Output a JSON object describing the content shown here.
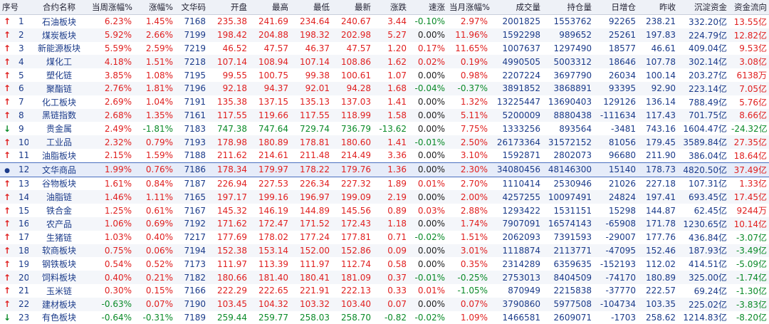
{
  "headers": [
    "序号",
    "合约名称",
    "当周涨幅%",
    "涨幅%",
    "文华码",
    "开盘",
    "最高",
    "最低",
    "最新",
    "涨跌",
    "速涨",
    "当月涨幅%",
    "成交量",
    "持仓量",
    "日增仓",
    "昨收",
    "沉淀资金",
    "资金流向"
  ],
  "rows": [
    {
      "arrow": "up",
      "n": "1",
      "name": "石油板块",
      "week": "6.23%",
      "chg": "1.45%",
      "code": "7168",
      "open": "235.38",
      "high": "241.69",
      "low": "234.64",
      "last": "240.67",
      "diff": "3.44",
      "speed": "-0.10%",
      "month": "2.97%",
      "vol": "2001825",
      "oi": "1553762",
      "doi": "92265",
      "prev": "238.21",
      "fund": "332.20亿",
      "flow": "13.55亿"
    },
    {
      "arrow": "up",
      "n": "2",
      "name": "煤炭板块",
      "week": "5.92%",
      "chg": "2.66%",
      "code": "7199",
      "open": "198.42",
      "high": "204.88",
      "low": "198.32",
      "last": "202.98",
      "diff": "5.27",
      "speed": "0.00%",
      "month": "11.96%",
      "vol": "1592298",
      "oi": "989652",
      "doi": "25261",
      "prev": "197.83",
      "fund": "224.79亿",
      "flow": "12.82亿"
    },
    {
      "arrow": "up",
      "n": "3",
      "name": "新能源板块",
      "week": "5.59%",
      "chg": "2.59%",
      "code": "7219",
      "open": "46.52",
      "high": "47.57",
      "low": "46.37",
      "last": "47.57",
      "diff": "1.20",
      "speed": "0.17%",
      "month": "11.65%",
      "vol": "1007637",
      "oi": "1297490",
      "doi": "18577",
      "prev": "46.61",
      "fund": "409.04亿",
      "flow": "9.53亿"
    },
    {
      "arrow": "up",
      "n": "4",
      "name": "煤化工",
      "week": "4.18%",
      "chg": "1.51%",
      "code": "7218",
      "open": "107.14",
      "high": "108.94",
      "low": "107.14",
      "last": "108.86",
      "diff": "1.62",
      "speed": "0.02%",
      "month": "0.19%",
      "vol": "4990505",
      "oi": "5003312",
      "doi": "18646",
      "prev": "107.78",
      "fund": "302.14亿",
      "flow": "3.08亿"
    },
    {
      "arrow": "up",
      "n": "5",
      "name": "塑化链",
      "week": "3.85%",
      "chg": "1.08%",
      "code": "7195",
      "open": "99.55",
      "high": "100.75",
      "low": "99.38",
      "last": "100.61",
      "diff": "1.07",
      "speed": "0.00%",
      "month": "0.98%",
      "vol": "2207224",
      "oi": "3697790",
      "doi": "26034",
      "prev": "100.14",
      "fund": "203.27亿",
      "flow": "6138万"
    },
    {
      "arrow": "up",
      "n": "6",
      "name": "聚酯链",
      "week": "2.76%",
      "chg": "1.81%",
      "code": "7196",
      "open": "92.18",
      "high": "94.37",
      "low": "92.01",
      "last": "94.28",
      "diff": "1.68",
      "speed": "-0.04%",
      "month": "-0.37%",
      "vol": "3891852",
      "oi": "3868891",
      "doi": "93395",
      "prev": "92.90",
      "fund": "223.14亿",
      "flow": "7.05亿"
    },
    {
      "arrow": "up",
      "n": "7",
      "name": "化工板块",
      "week": "2.69%",
      "chg": "1.04%",
      "code": "7191",
      "open": "135.38",
      "high": "137.15",
      "low": "135.13",
      "last": "137.03",
      "diff": "1.41",
      "speed": "0.00%",
      "month": "1.32%",
      "vol": "13225447",
      "oi": "13690403",
      "doi": "129126",
      "prev": "136.14",
      "fund": "788.49亿",
      "flow": "5.76亿"
    },
    {
      "arrow": "up",
      "n": "8",
      "name": "黑链指数",
      "week": "2.68%",
      "chg": "1.35%",
      "code": "7161",
      "open": "117.55",
      "high": "119.66",
      "low": "117.55",
      "last": "118.99",
      "diff": "1.58",
      "speed": "0.00%",
      "month": "5.11%",
      "vol": "5200009",
      "oi": "8880438",
      "doi": "-111634",
      "prev": "117.43",
      "fund": "701.75亿",
      "flow": "8.66亿"
    },
    {
      "arrow": "down",
      "n": "9",
      "name": "贵金属",
      "week": "2.49%",
      "chg": "-1.81%",
      "code": "7183",
      "open": "747.38",
      "high": "747.64",
      "low": "729.74",
      "last": "736.79",
      "diff": "-13.62",
      "speed": "0.00%",
      "month": "7.75%",
      "vol": "1333256",
      "oi": "893564",
      "doi": "-3481",
      "prev": "743.16",
      "fund": "1604.47亿",
      "flow": "-24.32亿"
    },
    {
      "arrow": "up",
      "n": "10",
      "name": "工业品",
      "week": "2.32%",
      "chg": "0.79%",
      "code": "7193",
      "open": "178.98",
      "high": "180.89",
      "low": "178.81",
      "last": "180.60",
      "diff": "1.41",
      "speed": "-0.01%",
      "month": "2.50%",
      "vol": "26173364",
      "oi": "31572152",
      "doi": "81056",
      "prev": "179.45",
      "fund": "3589.84亿",
      "flow": "27.35亿"
    },
    {
      "arrow": "up",
      "n": "11",
      "name": "油脂板块",
      "week": "2.15%",
      "chg": "1.59%",
      "code": "7188",
      "open": "211.62",
      "high": "214.61",
      "low": "211.48",
      "last": "214.49",
      "diff": "3.36",
      "speed": "0.00%",
      "month": "3.10%",
      "vol": "1592871",
      "oi": "2802073",
      "doi": "96680",
      "prev": "211.90",
      "fund": "386.04亿",
      "flow": "18.64亿"
    },
    {
      "arrow": "dot",
      "n": "12",
      "name": "文华商品",
      "week": "1.99%",
      "chg": "0.76%",
      "code": "7186",
      "open": "178.34",
      "high": "179.97",
      "low": "178.22",
      "last": "179.76",
      "diff": "1.36",
      "speed": "0.00%",
      "month": "2.30%",
      "vol": "34080456",
      "oi": "48146300",
      "doi": "15140",
      "prev": "178.73",
      "fund": "4820.50亿",
      "flow": "37.49亿",
      "selected": true
    },
    {
      "arrow": "up",
      "n": "13",
      "name": "谷物板块",
      "week": "1.61%",
      "chg": "0.84%",
      "code": "7187",
      "open": "226.94",
      "high": "227.53",
      "low": "226.34",
      "last": "227.32",
      "diff": "1.89",
      "speed": "0.01%",
      "month": "2.70%",
      "vol": "1110414",
      "oi": "2530946",
      "doi": "21026",
      "prev": "227.18",
      "fund": "107.31亿",
      "flow": "1.33亿"
    },
    {
      "arrow": "up",
      "n": "14",
      "name": "油脂链",
      "week": "1.46%",
      "chg": "1.11%",
      "code": "7165",
      "open": "197.17",
      "high": "199.16",
      "low": "196.97",
      "last": "199.09",
      "diff": "2.19",
      "speed": "0.00%",
      "month": "2.00%",
      "vol": "4257255",
      "oi": "10097491",
      "doi": "24824",
      "prev": "197.41",
      "fund": "693.45亿",
      "flow": "17.45亿"
    },
    {
      "arrow": "up",
      "n": "15",
      "name": "铁合金",
      "week": "1.25%",
      "chg": "0.61%",
      "code": "7167",
      "open": "145.32",
      "high": "146.19",
      "low": "144.89",
      "last": "145.56",
      "diff": "0.89",
      "speed": "0.03%",
      "month": "2.88%",
      "vol": "1293422",
      "oi": "1531151",
      "doi": "15298",
      "prev": "144.87",
      "fund": "62.45亿",
      "flow": "9244万"
    },
    {
      "arrow": "up",
      "n": "16",
      "name": "农产品",
      "week": "1.06%",
      "chg": "0.69%",
      "code": "7192",
      "open": "171.62",
      "high": "172.47",
      "low": "171.52",
      "last": "172.43",
      "diff": "1.18",
      "speed": "0.00%",
      "month": "1.74%",
      "vol": "7907091",
      "oi": "16574143",
      "doi": "-65908",
      "prev": "171.78",
      "fund": "1230.65亿",
      "flow": "10.14亿"
    },
    {
      "arrow": "up",
      "n": "17",
      "name": "生猪链",
      "week": "1.03%",
      "chg": "0.40%",
      "code": "7217",
      "open": "177.69",
      "high": "178.02",
      "low": "177.24",
      "last": "177.81",
      "diff": "0.71",
      "speed": "-0.02%",
      "month": "1.51%",
      "vol": "2062093",
      "oi": "7391593",
      "doi": "-29007",
      "prev": "177.76",
      "fund": "436.84亿",
      "flow": "-3.07亿"
    },
    {
      "arrow": "up",
      "n": "18",
      "name": "软商板块",
      "week": "0.75%",
      "chg": "0.06%",
      "code": "7194",
      "open": "152.38",
      "high": "153.14",
      "low": "152.00",
      "last": "152.86",
      "diff": "0.09",
      "speed": "0.00%",
      "month": "3.01%",
      "vol": "1118874",
      "oi": "2113771",
      "doi": "-47095",
      "prev": "152.46",
      "fund": "187.93亿",
      "flow": "-3.49亿"
    },
    {
      "arrow": "up",
      "n": "19",
      "name": "钢铁板块",
      "week": "0.54%",
      "chg": "0.52%",
      "code": "7173",
      "open": "111.97",
      "high": "113.39",
      "low": "111.97",
      "last": "112.74",
      "diff": "0.58",
      "speed": "0.00%",
      "month": "0.35%",
      "vol": "2314289",
      "oi": "6359635",
      "doi": "-152193",
      "prev": "112.02",
      "fund": "414.51亿",
      "flow": "-5.09亿"
    },
    {
      "arrow": "up",
      "n": "20",
      "name": "饲料板块",
      "week": "0.40%",
      "chg": "0.21%",
      "code": "7182",
      "open": "180.66",
      "high": "181.40",
      "low": "180.41",
      "last": "181.09",
      "diff": "0.37",
      "speed": "-0.01%",
      "month": "-0.25%",
      "vol": "2753013",
      "oi": "8404509",
      "doi": "-74170",
      "prev": "180.89",
      "fund": "325.00亿",
      "flow": "-1.74亿"
    },
    {
      "arrow": "up",
      "n": "21",
      "name": "玉米链",
      "week": "0.30%",
      "chg": "0.15%",
      "code": "7166",
      "open": "222.29",
      "high": "222.65",
      "low": "221.91",
      "last": "222.13",
      "diff": "0.33",
      "speed": "0.01%",
      "month": "-1.05%",
      "vol": "870949",
      "oi": "2215838",
      "doi": "-37770",
      "prev": "222.57",
      "fund": "69.24亿",
      "flow": "-1.30亿"
    },
    {
      "arrow": "up",
      "n": "22",
      "name": "建材板块",
      "week": "-0.63%",
      "chg": "0.07%",
      "code": "7190",
      "open": "103.45",
      "high": "104.32",
      "low": "103.32",
      "last": "103.40",
      "diff": "0.07",
      "speed": "0.00%",
      "month": "0.07%",
      "vol": "3790860",
      "oi": "5977508",
      "doi": "-104734",
      "prev": "103.35",
      "fund": "225.02亿",
      "flow": "-3.83亿"
    },
    {
      "arrow": "down",
      "n": "23",
      "name": "有色板块",
      "week": "-0.64%",
      "chg": "-0.31%",
      "code": "7189",
      "open": "259.44",
      "high": "259.77",
      "low": "258.03",
      "last": "258.70",
      "diff": "-0.82",
      "speed": "-0.02%",
      "month": "1.09%",
      "vol": "1466581",
      "oi": "2609071",
      "doi": "-1703",
      "prev": "258.62",
      "fund": "1214.83亿",
      "flow": "-8.20亿"
    }
  ],
  "colors": {
    "up": "#e02020",
    "down": "#0a8a28",
    "blue": "#1b3b8a",
    "header_bg": "#eef1f7"
  }
}
